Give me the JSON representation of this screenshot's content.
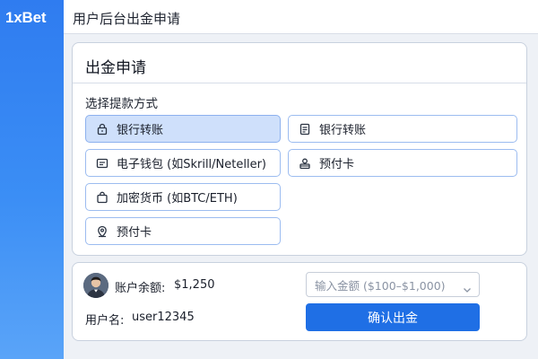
{
  "app": {
    "logo": "1xBet",
    "page_title": "用户后台出金申请"
  },
  "withdraw_card": {
    "title": "出金申请",
    "section_label": "选择提款方式",
    "options": [
      {
        "label": "银行转账",
        "icon": "lock-icon",
        "selected": true
      },
      {
        "label": "银行转账",
        "icon": "receipt-icon",
        "selected": false
      },
      {
        "label": "电子钱包 (如Skrill/Neteller)",
        "icon": "wallet-icon",
        "selected": false
      },
      {
        "label": "预付卡",
        "icon": "card-stack-icon",
        "selected": false
      },
      {
        "label": "加密货币 (如BTC/ETH)",
        "icon": "bag-icon",
        "selected": false
      },
      {
        "label": "预付卡",
        "icon": "location-tag-icon",
        "selected": false
      }
    ]
  },
  "account": {
    "balance_label": "账户余额:",
    "balance_value": "$1,250",
    "username_label": "用户名:",
    "username_value": "user12345",
    "amount_placeholder": "输入金额 ($100–$1,000)",
    "confirm_label": "确认出金"
  },
  "colors": {
    "sidebar": "#3b8ef5",
    "accent": "#1f6fe5",
    "selected_option": "#cfe0fb",
    "option_border": "#9cbcf0"
  }
}
